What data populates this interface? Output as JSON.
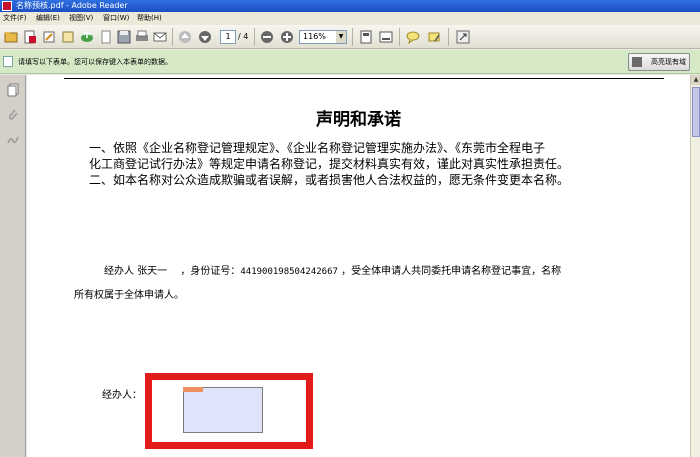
{
  "window": {
    "title": "名称预核.pdf - Adobe Reader"
  },
  "menu": [
    "文件(F)",
    "编辑(E)",
    "视图(V)",
    "窗口(W)",
    "帮助(H)"
  ],
  "toolbar": {
    "page_current": "1",
    "page_total": "/ 4",
    "zoom": "116%"
  },
  "notice": {
    "text": "请填写以下表单。您可以保存键入本表单的数据。",
    "highlight_button": "高亮现有域"
  },
  "document": {
    "title": "声明和承诺",
    "para1_line1": "一、依照《企业名称登记管理规定》、《企业名称登记管理实施办法》、《东莞市全程电子",
    "para1_line2": "化工商登记试行办法》等规定申请名称登记，提交材料真实有效，谨此对真实性承担责任。",
    "para2": "二、如本名称对公众造成欺骗或者误解，或者损害他人合法权益的，愿无条件变更本名称。",
    "agent_label": "经办人",
    "agent_name": "张天一",
    "id_label": "，身份证号：",
    "id_number": "441900198504242667",
    "statement_end": "，受全体申请人共同委托申请名称登记事宜，名称",
    "statement_line2": "所有权属于全体申请人。",
    "signature_label": "经办人："
  }
}
